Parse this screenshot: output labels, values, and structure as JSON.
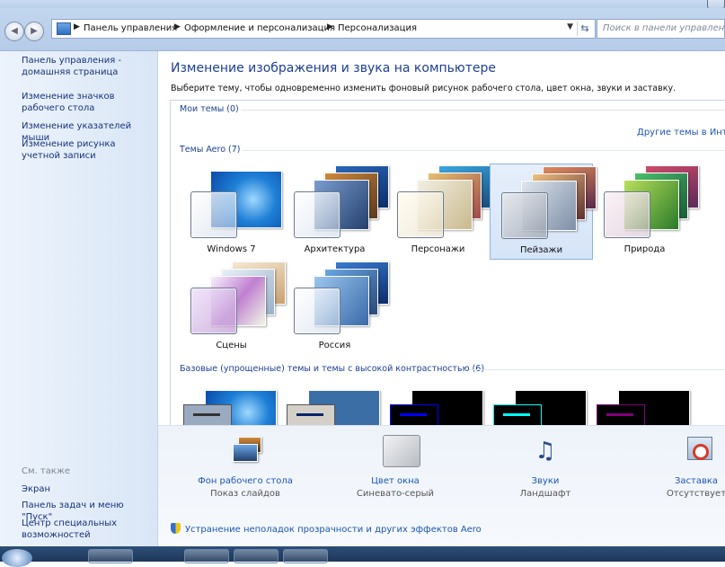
{
  "address_bar": {
    "crumbs": [
      "Панель управления",
      "Оформление и персонализация",
      "Персонализация"
    ]
  },
  "search": {
    "placeholder": "Поиск в панели управления"
  },
  "sidebar": {
    "links": [
      "Панель управления - домашняя страница",
      "Изменение значков рабочего стола",
      "Изменение указателей мыши",
      "Изменение рисунка учетной записи"
    ],
    "see_also_label": "См. также",
    "see_also": [
      "Экран",
      "Панель задач и меню \"Пуск\"",
      "Центр специальных возможностей"
    ]
  },
  "main": {
    "heading": "Изменение изображения и звука на компьютере",
    "subtitle": "Выберите тему, чтобы одновременно изменить фоновый рисунок рабочего стола, цвет окна, звуки и заставку.",
    "group_my": "Мои темы (0)",
    "more_themes": "Другие темы в Интер",
    "group_aero": "Темы Aero (7)",
    "aero_themes": [
      "Windows 7",
      "Архитектура",
      "Персонажи",
      "Пейзажи",
      "Природа",
      "Сцены",
      "Россия"
    ],
    "selected_theme": "Пейзажи",
    "group_basic": "Базовые (упрощенные) темы и темы с высокой контрастностью (6)"
  },
  "bottom": {
    "items": [
      {
        "label": "Фон рабочего стола",
        "value": "Показ слайдов",
        "icon": "desktop-background-icon"
      },
      {
        "label": "Цвет окна",
        "value": "Синевато-серый",
        "icon": "window-color-icon"
      },
      {
        "label": "Звуки",
        "value": "Ландшафт",
        "icon": "sounds-icon"
      },
      {
        "label": "Заставка",
        "value": "Отсутствует",
        "icon": "screensaver-icon"
      }
    ],
    "troubleshoot": "Устранение неполадок прозрачности и других эффектов Aero"
  },
  "colors": {
    "link": "#1c56b0",
    "heading": "#1c3f94",
    "selection": "#d5e4f7",
    "sidebar": "#e3ecf8"
  }
}
